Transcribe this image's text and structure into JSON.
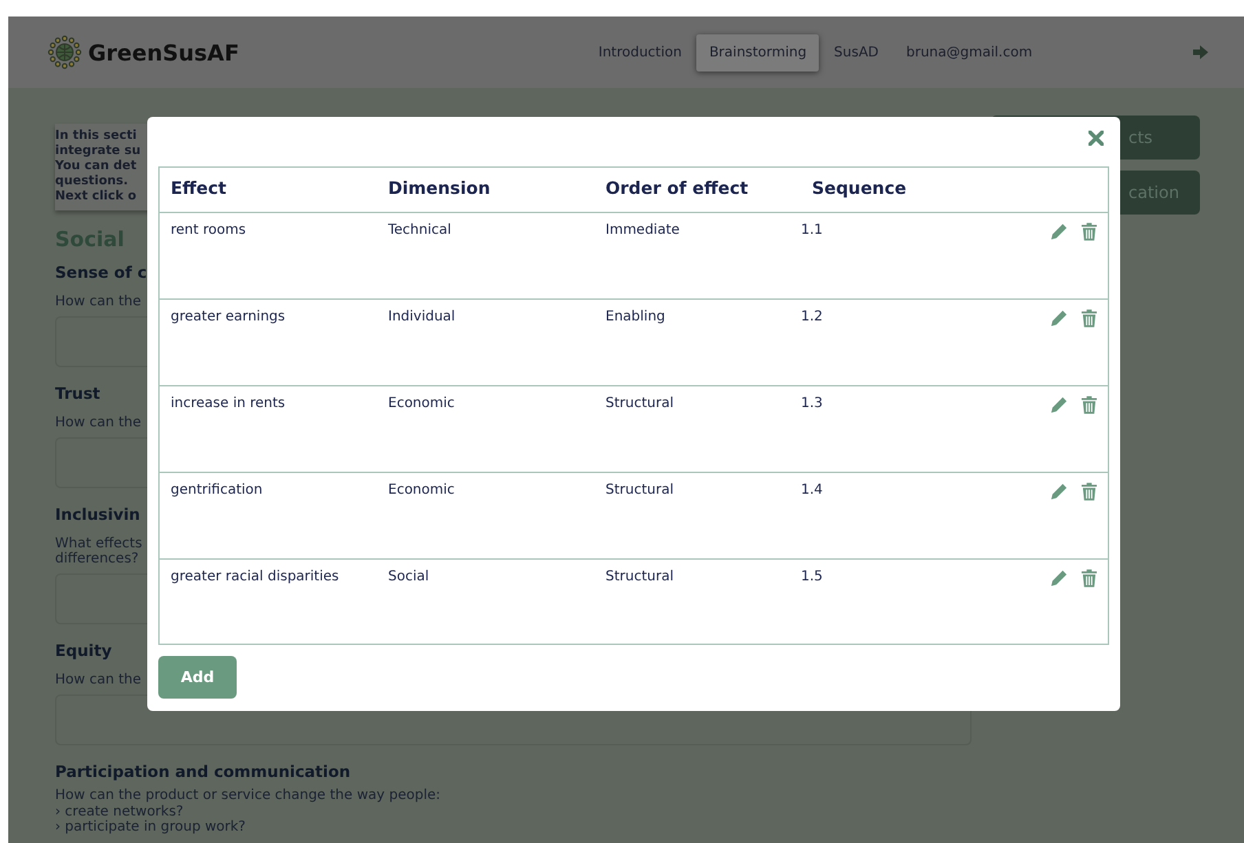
{
  "header": {
    "logo": "GreenSusAF",
    "nav": [
      {
        "label": "Introduction",
        "selected": false
      },
      {
        "label": "Brainstorming",
        "selected": true
      },
      {
        "label": "SusAD",
        "selected": false
      },
      {
        "label": "bruna@gmail.com",
        "selected": false
      }
    ]
  },
  "page": {
    "intro": [
      "In this secti",
      "integrate su",
      "You can det",
      "questions.",
      "Next click o"
    ],
    "section": "Social",
    "questions": [
      {
        "title": "Sense of c",
        "text": [
          "How can the"
        ]
      },
      {
        "title": "Trust",
        "text": [
          "How can the"
        ]
      },
      {
        "title": "Inclusivin",
        "text": [
          "What effects",
          "differences?"
        ]
      },
      {
        "title": "Equity",
        "text": [
          "How can the"
        ]
      }
    ],
    "last": {
      "title": "Participation and communication",
      "text": [
        "How can the product or service change the way people:",
        "› create networks?",
        "› participate in group work?"
      ]
    },
    "side_buttons": [
      "cts",
      "cation"
    ]
  },
  "modal": {
    "columns": [
      "Effect",
      "Dimension",
      "Order of effect",
      "Sequence"
    ],
    "rows": [
      [
        "rent rooms",
        "Technical",
        "Immediate",
        "1.1"
      ],
      [
        "greater earnings",
        "Individual",
        "Enabling",
        "1.2"
      ],
      [
        "increase in rents",
        "Economic",
        "Structural",
        "1.3"
      ],
      [
        "gentrification",
        "Economic",
        "Structural",
        "1.4"
      ],
      [
        "greater racial disparities",
        "Social",
        "Structural",
        "1.5"
      ]
    ],
    "add_button": "Add"
  }
}
